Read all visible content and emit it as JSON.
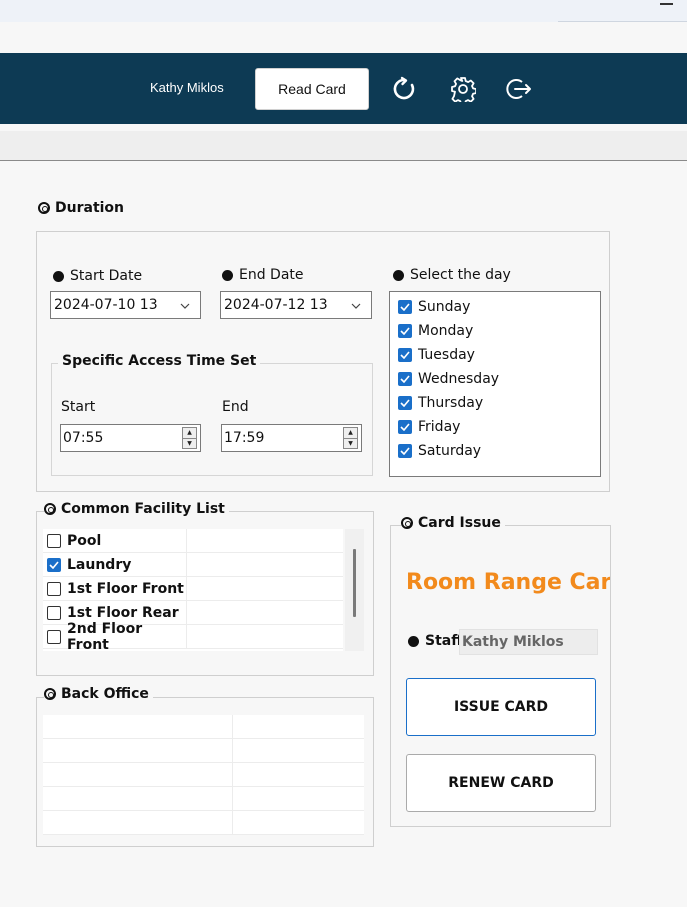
{
  "header": {
    "user_name": "Kathy Miklos",
    "read_card_label": "Read Card",
    "icons": [
      "refresh-icon",
      "gear-icon",
      "logout-icon"
    ],
    "bg_color": "#0d3a54"
  },
  "duration": {
    "title": "Duration",
    "start_date_label": "Start Date",
    "start_date_value": "2024-07-10 13",
    "end_date_label": "End Date",
    "end_date_value": "2024-07-12 13",
    "access_time_title": "Specific Access Time Set",
    "start_label": "Start",
    "start_value": "07:55",
    "end_label": "End",
    "end_value": "17:59",
    "select_day_label": "Select the day",
    "days": [
      {
        "label": "Sunday",
        "checked": true
      },
      {
        "label": "Monday",
        "checked": true
      },
      {
        "label": "Tuesday",
        "checked": true
      },
      {
        "label": "Wednesday",
        "checked": true
      },
      {
        "label": "Thursday",
        "checked": true
      },
      {
        "label": "Friday",
        "checked": true
      },
      {
        "label": "Saturday",
        "checked": true
      }
    ]
  },
  "facilities": {
    "title": "Common Facility List",
    "items": [
      {
        "label": "Pool",
        "checked": false
      },
      {
        "label": "Laundry",
        "checked": true
      },
      {
        "label": "1st Floor Front",
        "checked": false
      },
      {
        "label": "1st Floor Rear",
        "checked": false
      },
      {
        "label": "2nd Floor Front",
        "checked": false
      }
    ]
  },
  "back_office": {
    "title": "Back Office"
  },
  "card_issue": {
    "title": "Card Issue",
    "heading": "Room Range Card",
    "staff_label": "Staff",
    "staff_value": "Kathy Miklos",
    "issue_label": "ISSUE CARD",
    "renew_label": "RENEW CARD",
    "accent_color": "#f28a1c"
  }
}
